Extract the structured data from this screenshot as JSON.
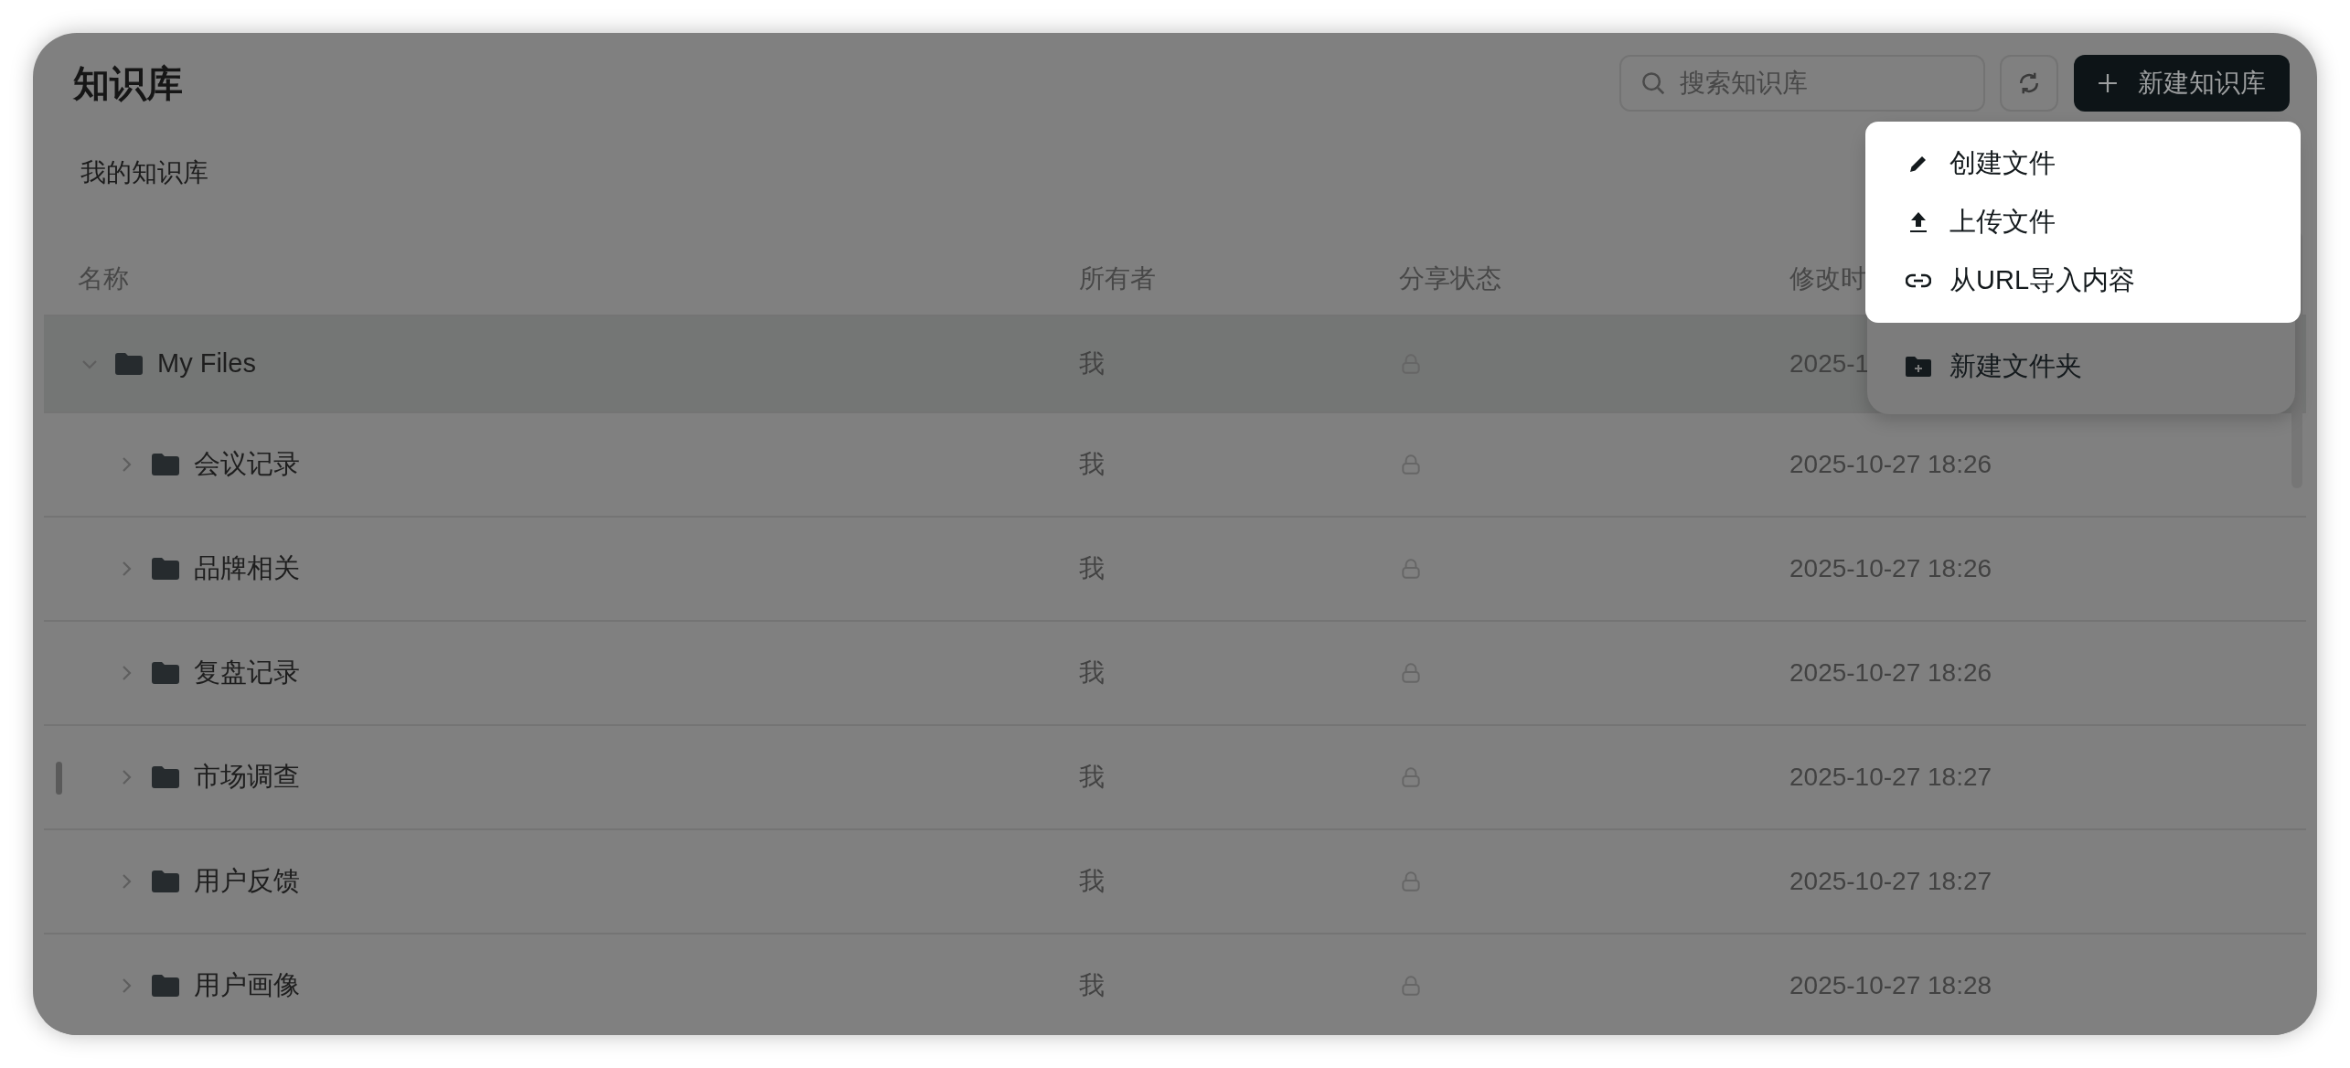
{
  "title": "知识库",
  "search": {
    "placeholder": "搜索知识库"
  },
  "new_button": {
    "label": "新建知识库"
  },
  "section_label": "我的知识库",
  "table": {
    "columns": [
      "名称",
      "所有者",
      "分享状态",
      "修改时"
    ],
    "rows": [
      {
        "name": "My Files",
        "owner": "我",
        "modified": "2025-1",
        "expanded": true,
        "selected": true,
        "children": [
          {
            "name": "会议记录",
            "owner": "我",
            "modified": "2025-10-27 18:26",
            "expanded": false,
            "selected": false
          },
          {
            "name": "品牌相关",
            "owner": "我",
            "modified": "2025-10-27 18:26",
            "expanded": false,
            "selected": false
          },
          {
            "name": "复盘记录",
            "owner": "我",
            "modified": "2025-10-27 18:26",
            "expanded": false,
            "selected": false
          },
          {
            "name": "市场调查",
            "owner": "我",
            "modified": "2025-10-27 18:27",
            "expanded": false,
            "selected": false
          },
          {
            "name": "用户反馈",
            "owner": "我",
            "modified": "2025-10-27 18:27",
            "expanded": false,
            "selected": false
          },
          {
            "name": "用户画像",
            "owner": "我",
            "modified": "2025-10-27 18:28",
            "expanded": false,
            "selected": false
          }
        ]
      }
    ]
  },
  "menu": {
    "items": [
      {
        "label": "创建文件",
        "kind": "pencil",
        "spotlighted": true
      },
      {
        "label": "上传文件",
        "kind": "upload",
        "spotlighted": true
      },
      {
        "label": "从URL导入内容",
        "kind": "link",
        "spotlighted": true
      },
      {
        "label": "新建文件夹",
        "kind": "folder-plus",
        "spotlighted": false
      }
    ]
  }
}
